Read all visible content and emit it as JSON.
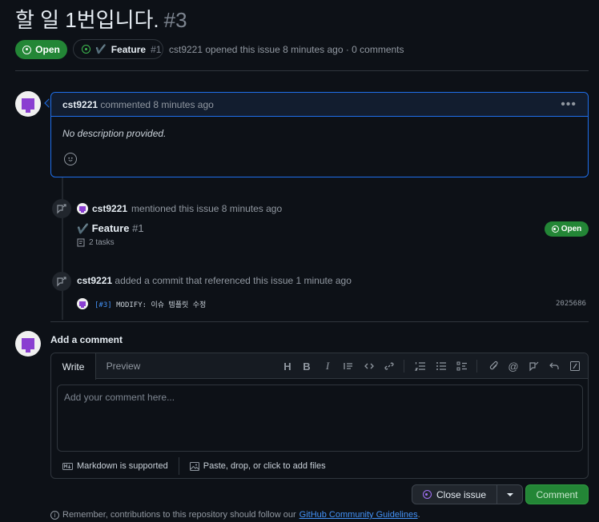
{
  "issue": {
    "title": "할 일 1번입니다.",
    "number": "#3",
    "status": "Open",
    "linked_feature_check": "✔️",
    "linked_feature_name": "Feature",
    "linked_feature_number": "#1",
    "author": "cst9221",
    "opened_text": "opened this issue 8 minutes ago · 0 comments"
  },
  "comment": {
    "author": "cst9221",
    "action": "commented 8 minutes ago",
    "body": "No description provided.",
    "menu_icon": "kebab-horizontal-icon"
  },
  "timeline": {
    "mention": {
      "author": "cst9221",
      "action": "mentioned this issue 8 minutes ago",
      "ref_check": "✔️",
      "ref_title": "Feature",
      "ref_number": "#1",
      "ref_tasks": "2 tasks",
      "ref_status": "Open"
    },
    "commit": {
      "author": "cst9221",
      "action": "added a commit that referenced this issue 1 minute ago",
      "message_ref": "[#3]",
      "message": " MODIFY: 이슈 템플릿 수정",
      "sha": "2025686"
    }
  },
  "composer": {
    "heading": "Add a comment",
    "tab_write": "Write",
    "tab_preview": "Preview",
    "placeholder": "Add your comment here...",
    "markdown_note": "Markdown is supported",
    "attach_note": "Paste, drop, or click to add files",
    "close_label": "Close issue",
    "comment_label": "Comment"
  },
  "footer": {
    "remember_prefix": "Remember, contributions to this repository should follow our",
    "guidelines_link": "GitHub Community Guidelines",
    "suffix": "."
  },
  "colors": {
    "open_green": "#238636",
    "accent_blue": "#1f6feb",
    "close_purple": "#a371f7"
  }
}
